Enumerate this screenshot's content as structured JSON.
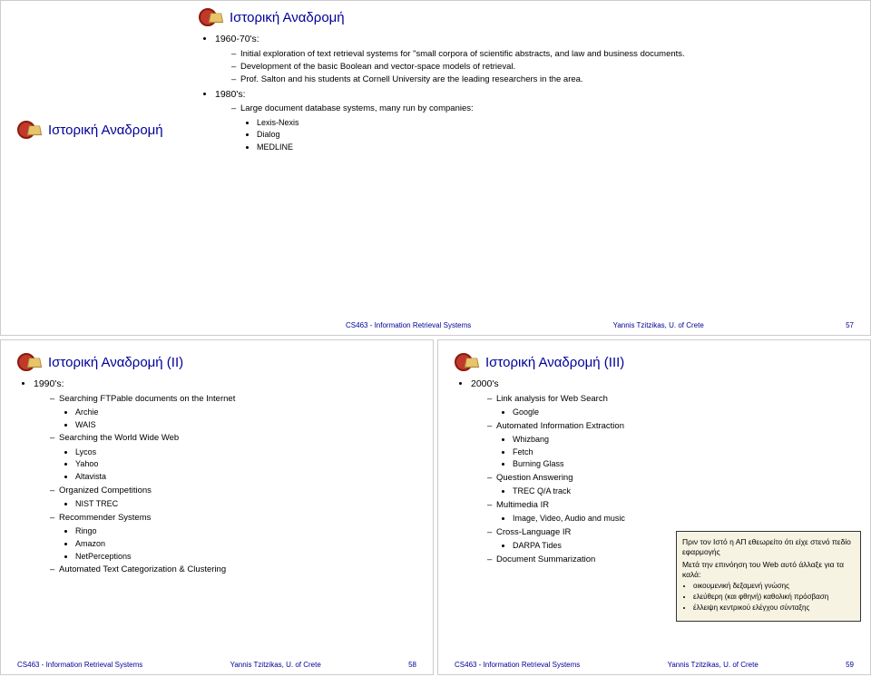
{
  "slides": {
    "s1": {
      "left_title": "Ιστορική Αναδρομή",
      "title": "Ιστορική Αναδρομή",
      "h1960": "1960-70's:",
      "h1960_items": [
        "Initial exploration of text retrieval systems for \"small corpora of scientific abstracts, and law and business documents.",
        "Development of the basic Boolean and vector-space models of retrieval.",
        "Prof. Salton and his students at Cornell University are the leading researchers in the area."
      ],
      "h1980": "1980's:",
      "h1980_intro": "Large document database systems, many run by companies:",
      "h1980_items": [
        "Lexis-Nexis",
        "Dialog",
        "MEDLINE"
      ]
    },
    "s2": {
      "title": "Ιστορική Αναδρομή (II)",
      "h1990": "1990's:",
      "g1": "Searching FTPable documents on the Internet",
      "g1_items": [
        "Archie",
        "WAIS"
      ],
      "g2": "Searching the World Wide Web",
      "g2_items": [
        "Lycos",
        "Yahoo",
        "Altavista"
      ],
      "g3": "Organized Competitions",
      "g3_items": [
        "NIST TREC"
      ],
      "g4": "Recommender Systems",
      "g4_items": [
        "Ringo",
        "Amazon",
        "NetPerceptions"
      ],
      "g5": "Automated Text Categorization & Clustering"
    },
    "s3": {
      "title": "Ιστορική Αναδρομή (III)",
      "h2000": "2000's",
      "g1": "Link analysis for Web Search",
      "g1_items": [
        "Google"
      ],
      "g2": "Automated Information Extraction",
      "g2_items": [
        "Whizbang",
        "Fetch",
        "Burning Glass"
      ],
      "g3": "Question Answering",
      "g3_items": [
        "TREC Q/A track"
      ],
      "g4": "Multimedia IR",
      "g4_items": [
        "Image, Video, Audio and music"
      ],
      "g5": "Cross-Language IR",
      "g5_items": [
        "DARPA Tides"
      ],
      "g6": "Document Summarization",
      "callout": {
        "p1": "Πριν τον Ιστό η ΑΠ εθεωρείτο ότι είχε στενό πεδίο εφαρμογής",
        "p2": "Μετά την επινόηση του Web αυτό άλλαξε για τα καλά:",
        "items": [
          "οικουμενική δεξαμενή γνώσης",
          "ελεύθερη (και φθηνή) καθολική πρόσβαση",
          "έλλειψη κεντρικού ελέγχου σύνταξης"
        ]
      }
    },
    "footer": {
      "left": "CS463 - Information Retrieval Systems",
      "center": "Yannis Tzitzikas, U. of Crete"
    },
    "page_numbers": {
      "s1": "57",
      "s2": "58",
      "s3": "59"
    }
  }
}
